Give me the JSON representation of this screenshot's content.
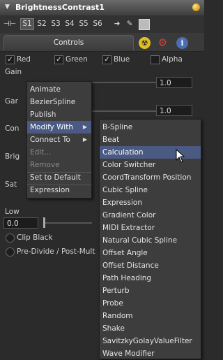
{
  "header": {
    "title": "BrightnessContrast1"
  },
  "toolbar": {
    "slots": [
      "S1",
      "S2",
      "S3",
      "S4",
      "S5",
      "S6"
    ],
    "selected_slot": "S1"
  },
  "tabs": {
    "controls_label": "Controls"
  },
  "channels": [
    {
      "label": "Red",
      "checked": true
    },
    {
      "label": "Green",
      "checked": true
    },
    {
      "label": "Blue",
      "checked": true
    },
    {
      "label": "Alpha",
      "checked": false
    }
  ],
  "params": {
    "gain_label": "Gain",
    "gain_value": "1.0",
    "gamma_label_partial": "Gar",
    "gamma_value": "1.0",
    "contrast_label_partial": "Con",
    "brightness_label_partial": "Brig",
    "saturation_label_partial": "Sat",
    "low_label": "Low",
    "low_value": "0.0",
    "clip_black_label": "Clip Black",
    "predivide_label": "Pre-Divide / Post-Mult"
  },
  "context_menu": {
    "items": [
      {
        "label": "Animate",
        "enabled": true
      },
      {
        "label": "BezierSpline",
        "enabled": true
      },
      {
        "label": "Publish",
        "enabled": true
      },
      {
        "label": "Modify With",
        "enabled": true,
        "submenu": true,
        "highlighted": true
      },
      {
        "label": "Connect To",
        "enabled": true,
        "submenu": true
      },
      {
        "label": "Edit...",
        "enabled": false
      },
      {
        "label": "Remove",
        "enabled": false
      },
      {
        "label": "Set to Default",
        "enabled": true
      },
      {
        "label": "Expression",
        "enabled": true
      }
    ]
  },
  "submenu": {
    "highlighted_item": "Calculation",
    "items": [
      "B-Spline",
      "Beat",
      "Calculation",
      "Color Switcher",
      "CoordTransform Position",
      "Cubic Spline",
      "Expression",
      "Gradient Color",
      "MIDI Extractor",
      "Natural Cubic Spline",
      "Offset Angle",
      "Offset Distance",
      "Path Heading",
      "Perturb",
      "Probe",
      "Random",
      "Shake",
      "SavitzkyGolayValueFilter",
      "Wave Modifier"
    ]
  },
  "colors": {
    "menu_highlight": "#4a5a82",
    "header_bg": "#5a5a5a",
    "panel_bg": "#2b2b2b"
  }
}
